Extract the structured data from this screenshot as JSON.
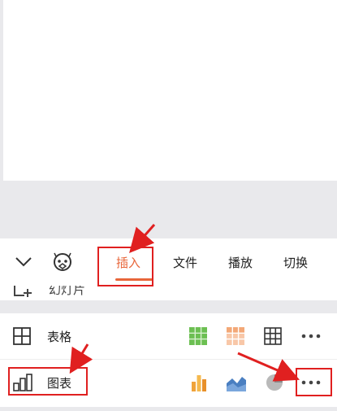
{
  "toolbar": {
    "tabs": [
      {
        "label": "插入",
        "active": true
      },
      {
        "label": "文件",
        "active": false
      },
      {
        "label": "播放",
        "active": false
      },
      {
        "label": "切换",
        "active": false
      }
    ],
    "collapse_icon": "chevron-down-icon",
    "smart_icon": "robot-face-icon",
    "accent_color": "#e8663a"
  },
  "slide_row": {
    "label": "幻灯片",
    "icon": "add-slide-icon"
  },
  "insert_panel": {
    "table_row": {
      "label": "表格",
      "icon": "table-grid-icon",
      "options": [
        "green-table-style-icon",
        "orange-table-style-icon",
        "plain-table-style-icon"
      ],
      "more_icon": "more-dots-icon"
    },
    "chart_row": {
      "label": "图表",
      "icon": "bar-chart-icon",
      "options": [
        "column-chart-icon",
        "area-chart-icon",
        "pie-chart-icon"
      ],
      "more_icon": "more-dots-icon"
    }
  },
  "annotation_color": "#e02020"
}
